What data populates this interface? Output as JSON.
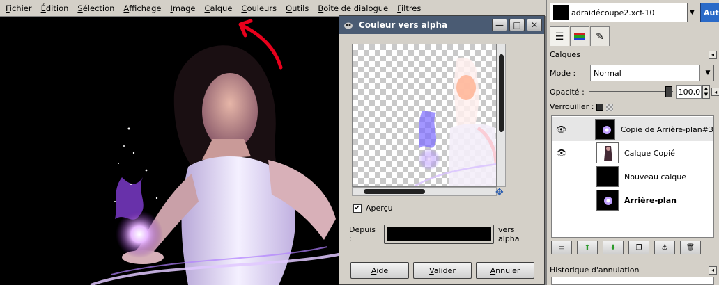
{
  "menu": {
    "items": [
      "Fichier",
      "Édition",
      "Sélection",
      "Affichage",
      "Image",
      "Calque",
      "Couleurs",
      "Outils",
      "Boîte de dialogue",
      "Filtres"
    ]
  },
  "dialog": {
    "title": "Couleur vers alpha",
    "preview_label": "Aperçu",
    "preview_checked": true,
    "from_label": "Depuis :",
    "to_label": "vers alpha",
    "from_color": "#000000",
    "buttons": {
      "help": "Aide",
      "ok": "Valider",
      "cancel": "Annuler"
    },
    "window_buttons": {
      "minimize": "—",
      "maximize": "□",
      "close": "✕"
    }
  },
  "dock": {
    "image_name": "adraidécoupe2.xcf-10",
    "auto_label": "Auto",
    "layers_title": "Calques",
    "mode_label": "Mode :",
    "mode_value": "Normal",
    "opacity_label": "Opacité :",
    "opacity_value": "100,0",
    "opacity_fraction": 1.0,
    "lock_label": "Verrouiller :",
    "layers": [
      {
        "name": "Copie de Arrière-plan#3",
        "visible": true,
        "selected": true,
        "bold": false
      },
      {
        "name": "Calque Copié",
        "visible": true,
        "selected": false,
        "bold": false
      },
      {
        "name": "Nouveau calque",
        "visible": false,
        "selected": false,
        "bold": false
      },
      {
        "name": "Arrière-plan",
        "visible": false,
        "selected": false,
        "bold": true
      }
    ],
    "history_title": "Historique d'annulation"
  },
  "colors": {
    "annotation_arrow": "#e8001c",
    "titlebar": "#4a5b73",
    "accent": "#2a6ac8"
  }
}
